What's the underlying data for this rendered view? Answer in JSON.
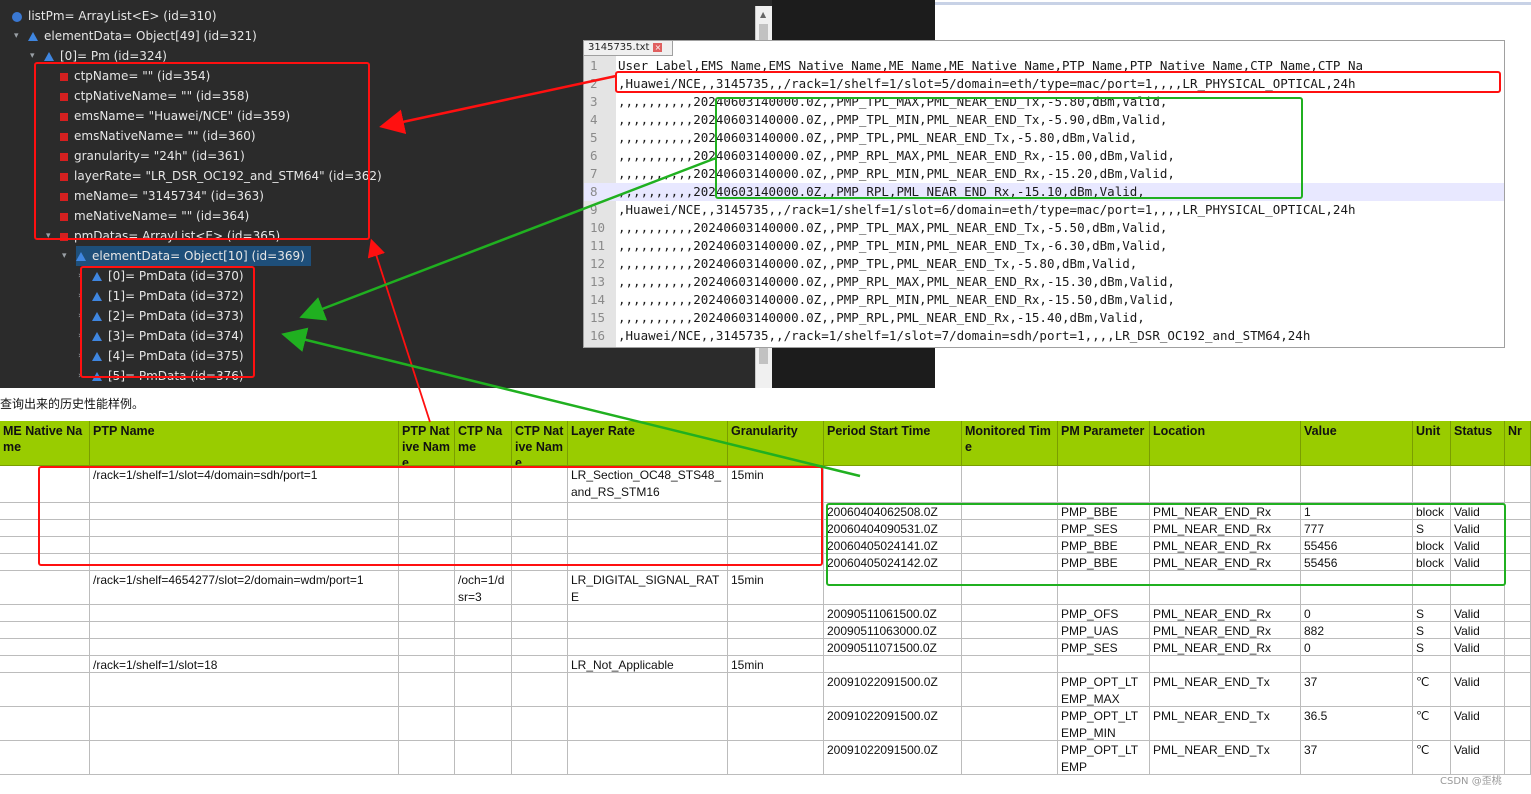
{
  "debug": {
    "rows": [
      {
        "text": "listPm= ArrayList<E>  (id=310)",
        "icon": "object-icon",
        "indent": 0,
        "twist": ""
      },
      {
        "text": "elementData= Object[49]  (id=321)",
        "icon": "field-icon",
        "indent": 1,
        "twist": "▾"
      },
      {
        "text": "[0]= Pm  (id=324)",
        "icon": "field-icon",
        "indent": 2,
        "twist": "▾"
      },
      {
        "text": "ctpName= \"\"  (id=354)",
        "icon": "private-field-icon",
        "indent": 3,
        "twist": ""
      },
      {
        "text": "ctpNativeName= \"\"  (id=358)",
        "icon": "private-field-icon",
        "indent": 3,
        "twist": ""
      },
      {
        "text": "emsName= \"Huawei/NCE\"  (id=359)",
        "icon": "private-field-icon",
        "indent": 3,
        "twist": ""
      },
      {
        "text": "emsNativeName= \"\"  (id=360)",
        "icon": "private-field-icon",
        "indent": 3,
        "twist": ""
      },
      {
        "text": "granularity= \"24h\"  (id=361)",
        "icon": "private-field-icon",
        "indent": 3,
        "twist": ""
      },
      {
        "text": "layerRate= \"LR_DSR_OC192_and_STM64\"  (id=362)",
        "icon": "private-field-icon",
        "indent": 3,
        "twist": ""
      },
      {
        "text": "meName= \"3145734\"  (id=363)",
        "icon": "private-field-icon",
        "indent": 3,
        "twist": ""
      },
      {
        "text": "meNativeName= \"\"  (id=364)",
        "icon": "private-field-icon",
        "indent": 3,
        "twist": ""
      },
      {
        "text": "pmDatas= ArrayList<E>  (id=365)",
        "icon": "private-field-icon",
        "indent": 3,
        "twist": "▾"
      },
      {
        "text": "elementData= Object[10]  (id=369)",
        "icon": "field-icon",
        "indent": 4,
        "twist": "▾",
        "selected": true
      },
      {
        "text": "[0]= PmData  (id=370)",
        "icon": "field-icon",
        "indent": 5,
        "twist": "›"
      },
      {
        "text": "[1]= PmData  (id=372)",
        "icon": "field-icon",
        "indent": 5,
        "twist": "›"
      },
      {
        "text": "[2]= PmData  (id=373)",
        "icon": "field-icon",
        "indent": 5,
        "twist": "›"
      },
      {
        "text": "[3]= PmData  (id=374)",
        "icon": "field-icon",
        "indent": 5,
        "twist": "›"
      },
      {
        "text": "[4]= PmData  (id=375)",
        "icon": "field-icon",
        "indent": 5,
        "twist": "›"
      },
      {
        "text": "[5]= PmData  (id=376)",
        "icon": "field-icon",
        "indent": 5,
        "twist": "›"
      }
    ]
  },
  "editor": {
    "tab_label": "3145735.txt",
    "tab_close": "×",
    "lines": [
      {
        "n": "1",
        "text": "User_Label,EMS_Name,EMS_Native_Name,ME_Name,ME_Native_Name,PTP_Name,PTP_Native_Name,CTP_Name,CTP_Na"
      },
      {
        "n": "2",
        "text": ",Huawei/NCE,,3145735,,/rack=1/shelf=1/slot=5/domain=eth/type=mac/port=1,,,,LR_PHYSICAL_OPTICAL,24h"
      },
      {
        "n": "3",
        "text": ",,,,,,,,,,20240603140000.0Z,,PMP_TPL_MAX,PML_NEAR_END_Tx,-5.80,dBm,Valid,"
      },
      {
        "n": "4",
        "text": ",,,,,,,,,,20240603140000.0Z,,PMP_TPL_MIN,PML_NEAR_END_Tx,-5.90,dBm,Valid,"
      },
      {
        "n": "5",
        "text": ",,,,,,,,,,20240603140000.0Z,,PMP_TPL,PML_NEAR_END_Tx,-5.80,dBm,Valid,"
      },
      {
        "n": "6",
        "text": ",,,,,,,,,,20240603140000.0Z,,PMP_RPL_MAX,PML_NEAR_END_Rx,-15.00,dBm,Valid,"
      },
      {
        "n": "7",
        "text": ",,,,,,,,,,20240603140000.0Z,,PMP_RPL_MIN,PML_NEAR_END_Rx,-15.20,dBm,Valid,"
      },
      {
        "n": "8",
        "text": ",,,,,,,,,,20240603140000.0Z,,PMP_RPL,PML_NEAR_END_Rx,-15.10,dBm,Valid,",
        "highlight": true
      },
      {
        "n": "9",
        "text": ",Huawei/NCE,,3145735,,/rack=1/shelf=1/slot=6/domain=eth/type=mac/port=1,,,,LR_PHYSICAL_OPTICAL,24h"
      },
      {
        "n": "10",
        "text": ",,,,,,,,,,20240603140000.0Z,,PMP_TPL_MAX,PML_NEAR_END_Tx,-5.50,dBm,Valid,"
      },
      {
        "n": "11",
        "text": ",,,,,,,,,,20240603140000.0Z,,PMP_TPL_MIN,PML_NEAR_END_Tx,-6.30,dBm,Valid,"
      },
      {
        "n": "12",
        "text": ",,,,,,,,,,20240603140000.0Z,,PMP_TPL,PML_NEAR_END_Tx,-5.80,dBm,Valid,"
      },
      {
        "n": "13",
        "text": ",,,,,,,,,,20240603140000.0Z,,PMP_RPL_MAX,PML_NEAR_END_Rx,-15.30,dBm,Valid,"
      },
      {
        "n": "14",
        "text": ",,,,,,,,,,20240603140000.0Z,,PMP_RPL_MIN,PML_NEAR_END_Rx,-15.50,dBm,Valid,"
      },
      {
        "n": "15",
        "text": ",,,,,,,,,,20240603140000.0Z,,PMP_RPL,PML_NEAR_END_Rx,-15.40,dBm,Valid,"
      },
      {
        "n": "16",
        "text": ",Huawei/NCE,,3145735,,/rack=1/shelf=1/slot=7/domain=sdh/port=1,,,,LR_DSR_OC192_and_STM64,24h"
      }
    ]
  },
  "sheet": {
    "caption": "查询出来的历史性能样例。",
    "headers": [
      "ME Native Name",
      "PTP Name",
      "PTP Native Name",
      "CTP Name",
      "CTP Native Name",
      "Layer Rate",
      "Granularity",
      "Period Start Time",
      "Monitored Time",
      "PM Parameter",
      "Location",
      "Value",
      "Unit",
      "Status",
      "Nr"
    ],
    "rows": [
      [
        "",
        "/rack=1/shelf=1/slot=4/domain=sdh/port=1",
        "",
        "",
        "",
        "LR_Section_OC48_STS48_and_RS_STM16",
        "15min",
        "",
        "",
        "",
        "",
        "",
        "",
        "",
        ""
      ],
      [
        "",
        "",
        "",
        "",
        "",
        "",
        "",
        "20060404062508.0Z",
        "",
        "PMP_BBE",
        "PML_NEAR_END_Rx",
        "1",
        "block",
        "Valid",
        ""
      ],
      [
        "",
        "",
        "",
        "",
        "",
        "",
        "",
        "20060404090531.0Z",
        "",
        "PMP_SES",
        "PML_NEAR_END_Rx",
        "777",
        "S",
        "Valid",
        ""
      ],
      [
        "",
        "",
        "",
        "",
        "",
        "",
        "",
        "20060405024141.0Z",
        "",
        "PMP_BBE",
        "PML_NEAR_END_Rx",
        "55456",
        "block",
        "Valid",
        ""
      ],
      [
        "",
        "",
        "",
        "",
        "",
        "",
        "",
        "20060405024142.0Z",
        "",
        "PMP_BBE",
        "PML_NEAR_END_Rx",
        "55456",
        "block",
        "Valid",
        ""
      ],
      [
        "",
        "/rack=1/shelf=4654277/slot=2/domain=wdm/port=1",
        "",
        "/och=1/dsr=3",
        "",
        "LR_DIGITAL_SIGNAL_RATE",
        "15min",
        "",
        "",
        "",
        "",
        "",
        "",
        "",
        ""
      ],
      [
        "",
        "",
        "",
        "",
        "",
        "",
        "",
        "20090511061500.0Z",
        "",
        "PMP_OFS",
        "PML_NEAR_END_Rx",
        "0",
        "S",
        "Valid",
        ""
      ],
      [
        "",
        "",
        "",
        "",
        "",
        "",
        "",
        "20090511063000.0Z",
        "",
        "PMP_UAS",
        "PML_NEAR_END_Rx",
        "882",
        "S",
        "Valid",
        ""
      ],
      [
        "",
        "",
        "",
        "",
        "",
        "",
        "",
        "20090511071500.0Z",
        "",
        "PMP_SES",
        "PML_NEAR_END_Rx",
        "0",
        "S",
        "Valid",
        ""
      ],
      [
        "",
        "/rack=1/shelf=1/slot=18",
        "",
        "",
        "",
        "LR_Not_Applicable",
        "15min",
        "",
        "",
        "",
        "",
        "",
        "",
        "",
        ""
      ],
      [
        "",
        "",
        "",
        "",
        "",
        "",
        "",
        "20091022091500.0Z",
        "",
        "PMP_OPT_LTEMP_MAX",
        "PML_NEAR_END_Tx",
        "37",
        "℃",
        "Valid",
        ""
      ],
      [
        "",
        "",
        "",
        "",
        "",
        "",
        "",
        "20091022091500.0Z",
        "",
        "PMP_OPT_LTEMP_MIN",
        "PML_NEAR_END_Tx",
        "36.5",
        "℃",
        "Valid",
        ""
      ],
      [
        "",
        "",
        "",
        "",
        "",
        "",
        "",
        "20091022091500.0Z",
        "",
        "PMP_OPT_LTEMP",
        "PML_NEAR_END_Tx",
        "37",
        "℃",
        "Valid",
        ""
      ]
    ]
  },
  "watermark": "CSDN @歪桃",
  "colors": {
    "annotation_red": "#ff1010",
    "annotation_green": "#20b020",
    "header_green": "#99cc00",
    "debug_bg": "#2b2b2b"
  }
}
